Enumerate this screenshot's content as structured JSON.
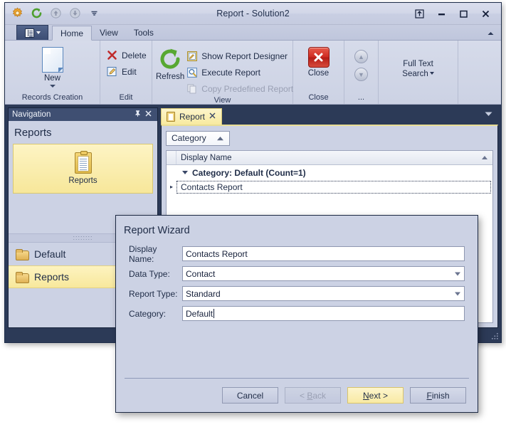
{
  "window": {
    "title": "Report - Solution2",
    "quick_access": [
      {
        "name": "app-settings-icon",
        "glyph": "gear"
      },
      {
        "name": "refresh-icon",
        "glyph": "refresh"
      },
      {
        "name": "undo-up-icon",
        "glyph": "up"
      },
      {
        "name": "redo-down-icon",
        "glyph": "down"
      },
      {
        "name": "customize-qat-icon",
        "glyph": "caret-down"
      }
    ],
    "controls": [
      {
        "name": "restore-layout-button",
        "glyph": "⤒"
      },
      {
        "name": "minimize-button",
        "glyph": "—"
      },
      {
        "name": "maximize-button",
        "glyph": "❑"
      },
      {
        "name": "close-button",
        "glyph": "✕"
      }
    ]
  },
  "ribbon": {
    "app_menu_label": "",
    "tabs": [
      {
        "label": "Home",
        "active": true
      },
      {
        "label": "View",
        "active": false
      },
      {
        "label": "Tools",
        "active": false
      }
    ],
    "collapse_label": "▲",
    "groups": [
      {
        "name": "records-creation",
        "label": "Records Creation",
        "big_buttons": [
          {
            "label": "New",
            "icon": "new-document-icon",
            "has_dropdown": true
          }
        ],
        "small_buttons": []
      },
      {
        "name": "edit",
        "label": "Edit",
        "big_buttons": [],
        "small_buttons": [
          {
            "label": "Delete",
            "icon": "delete-x-icon",
            "disabled": false
          },
          {
            "label": "Edit",
            "icon": "edit-pencil-icon",
            "disabled": false
          }
        ]
      },
      {
        "name": "view",
        "label": "View",
        "big_buttons": [
          {
            "label": "Refresh",
            "icon": "refresh-circular-arrow-icon",
            "has_dropdown": false
          }
        ],
        "small_buttons": [
          {
            "label": "Show Report Designer",
            "icon": "report-designer-icon",
            "disabled": false
          },
          {
            "label": "Execute Report",
            "icon": "execute-report-magnifier-icon",
            "disabled": false
          },
          {
            "label": "Copy Predefined Report",
            "icon": "copy-report-icon",
            "disabled": true
          }
        ]
      },
      {
        "name": "close",
        "label": "Close",
        "big_buttons": [
          {
            "label": "Close",
            "icon": "close-red-x-icon",
            "has_dropdown": false
          }
        ],
        "small_buttons": []
      },
      {
        "name": "more",
        "label": "...",
        "big_buttons": [],
        "small_buttons": [
          {
            "label": "",
            "icon": "move-up-circle-icon",
            "disabled": true
          },
          {
            "label": "",
            "icon": "move-down-circle-icon",
            "disabled": true
          }
        ]
      },
      {
        "name": "full-text-search",
        "label": "",
        "big_buttons": [
          {
            "label": "Full Text\nSearch",
            "icon": "",
            "has_dropdown": true
          }
        ],
        "small_buttons": []
      }
    ],
    "full_text_search": {
      "line1": "Full Text",
      "line2": "Search"
    }
  },
  "navigation": {
    "header_title": "Navigation",
    "pin_icon": "✕",
    "header_buttons": [
      {
        "name": "auto-hide-pin-icon",
        "glyph": "pin"
      },
      {
        "name": "close-panel-icon",
        "glyph": "✕"
      }
    ],
    "group_title": "Reports",
    "tile": {
      "label": "Reports",
      "icon": "reports-clipboard-icon"
    },
    "items": [
      {
        "label": "Default",
        "icon": "folder-icon",
        "selected": false
      },
      {
        "label": "Reports",
        "icon": "folder-icon",
        "selected": true
      }
    ]
  },
  "document": {
    "tab": {
      "label": "Report",
      "icon": "report-clipboard-icon",
      "close_glyph": "✕"
    },
    "tab_overflow_glyph": "▼",
    "filter_chip": {
      "label": "Category",
      "sort_glyph": "▲"
    },
    "grid": {
      "columns": [
        "Display Name"
      ],
      "sort_indicator": "ascending",
      "group_row": "Category: Default (Count=1)",
      "rows": [
        {
          "display_name": "Contacts Report",
          "selected": true
        }
      ]
    }
  },
  "dialog": {
    "title": "Report Wizard",
    "fields": [
      {
        "label": "Display Name:",
        "value": "Contacts Report",
        "type": "text",
        "focused": false
      },
      {
        "label": "Data Type:",
        "value": "Contact",
        "type": "combo",
        "focused": false
      },
      {
        "label": "Report Type:",
        "value": "Standard",
        "type": "combo",
        "focused": false
      },
      {
        "label": "Category:",
        "value": "Default",
        "type": "text",
        "focused": true
      }
    ],
    "buttons": [
      {
        "name": "cancel-button",
        "label": "Cancel",
        "mnemonic": "",
        "state": "normal"
      },
      {
        "name": "back-button",
        "label": "< Back",
        "mnemonic": "B",
        "state": "disabled"
      },
      {
        "name": "next-button",
        "label": "Next >",
        "mnemonic": "N",
        "state": "default"
      },
      {
        "name": "finish-button",
        "label": "Finish",
        "mnemonic": "F",
        "state": "normal"
      }
    ]
  },
  "colors": {
    "ribbon_bg": "#ccd2e4",
    "titlebar_bg": "#d2d7e8",
    "accent_navy": "#2c3a57",
    "selection_yellow": "#f8e89c",
    "danger_red": "#cf2c22",
    "refresh_green": "#4e9f2e"
  }
}
